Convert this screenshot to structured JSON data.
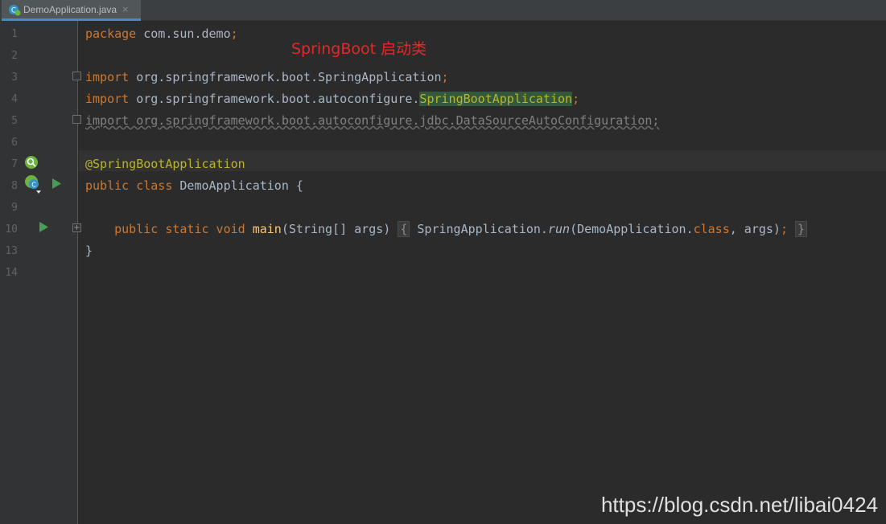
{
  "tab": {
    "filename": "DemoApplication.java",
    "close": "×",
    "icon": "spring-java-class-icon"
  },
  "gutter": {
    "line_numbers": [
      "1",
      "2",
      "3",
      "4",
      "5",
      "6",
      "7",
      "8",
      "9",
      "10",
      "13",
      "14"
    ]
  },
  "code": {
    "line1": {
      "kw": "package",
      "pkg": " com.sun.demo",
      "semi": ";"
    },
    "line3": {
      "kw": "import",
      "rest": " org.springframework.boot.SpringApplication",
      "semi": ";"
    },
    "line4": {
      "kw": "import",
      "rest": " org.springframework.boot.autoconfigure.",
      "hl": "SpringBootApplication",
      "semi": ";"
    },
    "line5": {
      "text": "import org.springframework.boot.autoconfigure.jdbc.DataSourceAutoConfiguration;"
    },
    "line7": {
      "ann": "@SpringBootApplication"
    },
    "line8": {
      "kw": "public class",
      "rest": " DemoApplication {"
    },
    "line10": {
      "indent": "    ",
      "kw": "public static void",
      "fn": "main",
      "params": "(String[] args) ",
      "open": "{",
      "body1": " SpringApplication.",
      "run": "run",
      "body2": "(DemoApplication.",
      "cls": "class",
      "body3": ", args)",
      "semi": ";",
      "close": "}"
    },
    "line13": {
      "text": "}"
    }
  },
  "annotation_note": "SpringBoot 启动类",
  "watermark": "https://blog.csdn.net/libai0424",
  "colors": {
    "background": "#2b2b2b",
    "keyword": "#cc7832",
    "annotation": "#bbb529",
    "method": "#ffc66d",
    "text": "#a9b7c6",
    "note": "#e02a2a"
  }
}
